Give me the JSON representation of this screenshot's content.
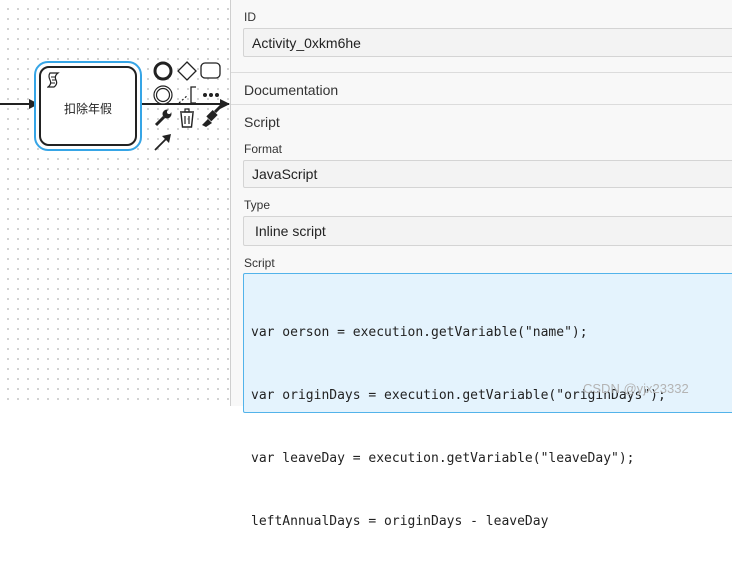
{
  "canvas": {
    "task": {
      "label": "扣除年假",
      "marker_icon": "script-task-marker-icon"
    },
    "context_pad": {
      "items": [
        "end-event-icon",
        "gateway-icon",
        "task-icon",
        "intermediate-event-icon",
        "text-annotation-icon",
        "more-options-icon",
        "change-type-wrench-icon",
        "delete-trash-icon",
        "color-brush-icon",
        "connect-arrow-icon"
      ]
    }
  },
  "panel": {
    "id_label": "ID",
    "id_value": "Activity_0xkm6he",
    "documentation_title": "Documentation",
    "script_title": "Script",
    "format_label": "Format",
    "format_value": "JavaScript",
    "type_label": "Type",
    "type_value": "Inline script",
    "script_label": "Script",
    "script_lines": [
      "var oerson = execution.getVariable(\"name\");",
      "var originDays = execution.getVariable(\"originDays\");",
      "var leaveDay = execution.getVariable(\"leaveDay\");",
      "leftAnnualDays = originDays - leaveDay"
    ]
  },
  "watermark": "CSDN @yjx23332",
  "colors": {
    "selection": "#36a5e6",
    "script_bg": "#e4f3fd",
    "panel_bg": "#f8f8f8"
  }
}
